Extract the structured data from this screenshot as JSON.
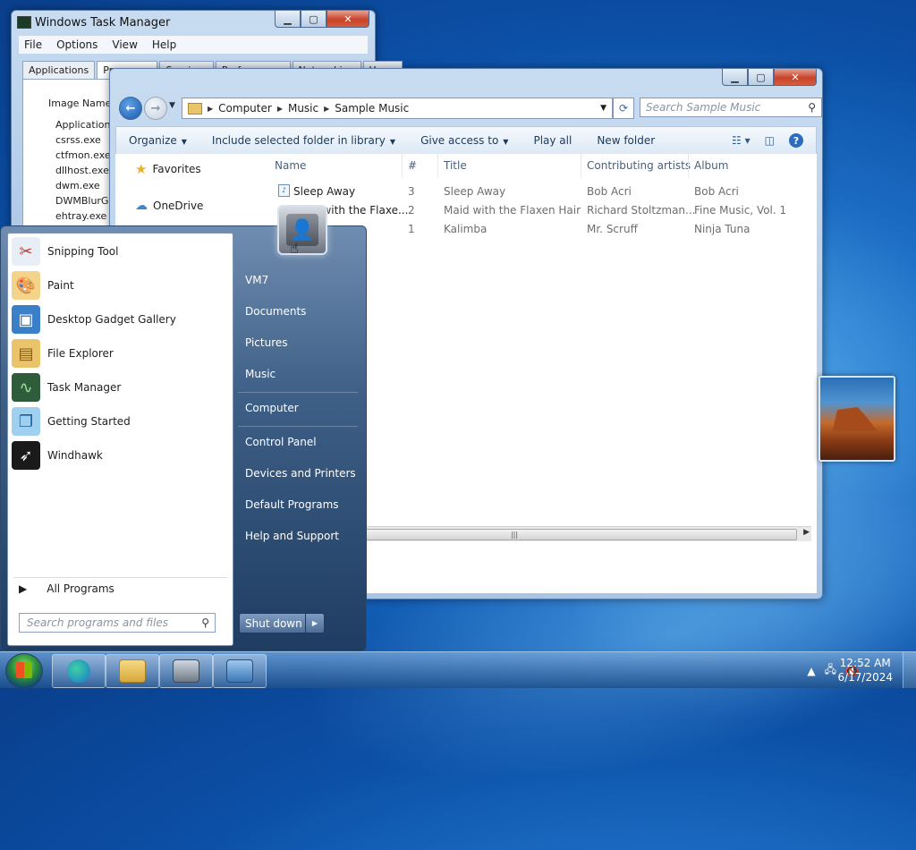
{
  "taskmanager": {
    "title": "Windows Task Manager",
    "menu": [
      "File",
      "Options",
      "View",
      "Help"
    ],
    "tabs": [
      "Applications",
      "Processes",
      "Services",
      "Performance",
      "Networking",
      "Users"
    ],
    "column_header": "Image Name",
    "processes": [
      "ApplicationFra...",
      "csrss.exe",
      "ctfmon.exe",
      "dllhost.exe",
      "dwm.exe",
      "DWMBlurGlass...",
      "ehtray.exe"
    ]
  },
  "explorer": {
    "breadcrumb": [
      "Computer",
      "Music",
      "Sample Music"
    ],
    "search_placeholder": "Search Sample Music",
    "commands": {
      "organize": "Organize",
      "include": "Include selected folder in library",
      "share": "Give access to",
      "play": "Play all",
      "newfolder": "New folder"
    },
    "nav": {
      "favorites": "Favorites",
      "onedrive": "OneDrive"
    },
    "columns": {
      "name": "Name",
      "num": "#",
      "title": "Title",
      "artist": "Contributing artists",
      "album": "Album"
    },
    "files": [
      {
        "name": "Sleep Away",
        "num": "3",
        "title": "Sleep Away",
        "artist": "Bob Acri",
        "album": "Bob Acri"
      },
      {
        "name": "Maid with the Flaxe...",
        "num": "2",
        "title": "Maid with the Flaxen Hair",
        "artist": "Richard Stoltzman...",
        "album": "Fine Music, Vol. 1"
      },
      {
        "name": "",
        "num": "1",
        "title": "Kalimba",
        "artist": "Mr. Scruff",
        "album": "Ninja Tuna"
      }
    ]
  },
  "start": {
    "programs": [
      {
        "label": "Snipping Tool",
        "icon": "scissors-icon",
        "color": "#e8eef6"
      },
      {
        "label": "Paint",
        "icon": "palette-icon",
        "color": "#f3d48a"
      },
      {
        "label": "Desktop Gadget Gallery",
        "icon": "gadget-icon",
        "color": "#3b7fc9"
      },
      {
        "label": "File Explorer",
        "icon": "folder-icon",
        "color": "#e9c46a"
      },
      {
        "label": "Task Manager",
        "icon": "taskmanager-icon",
        "color": "#2d5d3a"
      },
      {
        "label": "Getting Started",
        "icon": "document-icon",
        "color": "#9fd0f0"
      },
      {
        "label": "Windhawk",
        "icon": "hawk-icon",
        "color": "#1a1a1a"
      }
    ],
    "all_programs": "All Programs",
    "search_placeholder": "Search programs and files",
    "right_links": [
      "VM7",
      "Documents",
      "Pictures",
      "Music",
      "Computer",
      "Control Panel",
      "Devices and Printers",
      "Default Programs",
      "Help and Support"
    ],
    "shutdown": "Shut down"
  },
  "taskbar": {
    "time": "12:52 AM",
    "date": "6/17/2024"
  }
}
